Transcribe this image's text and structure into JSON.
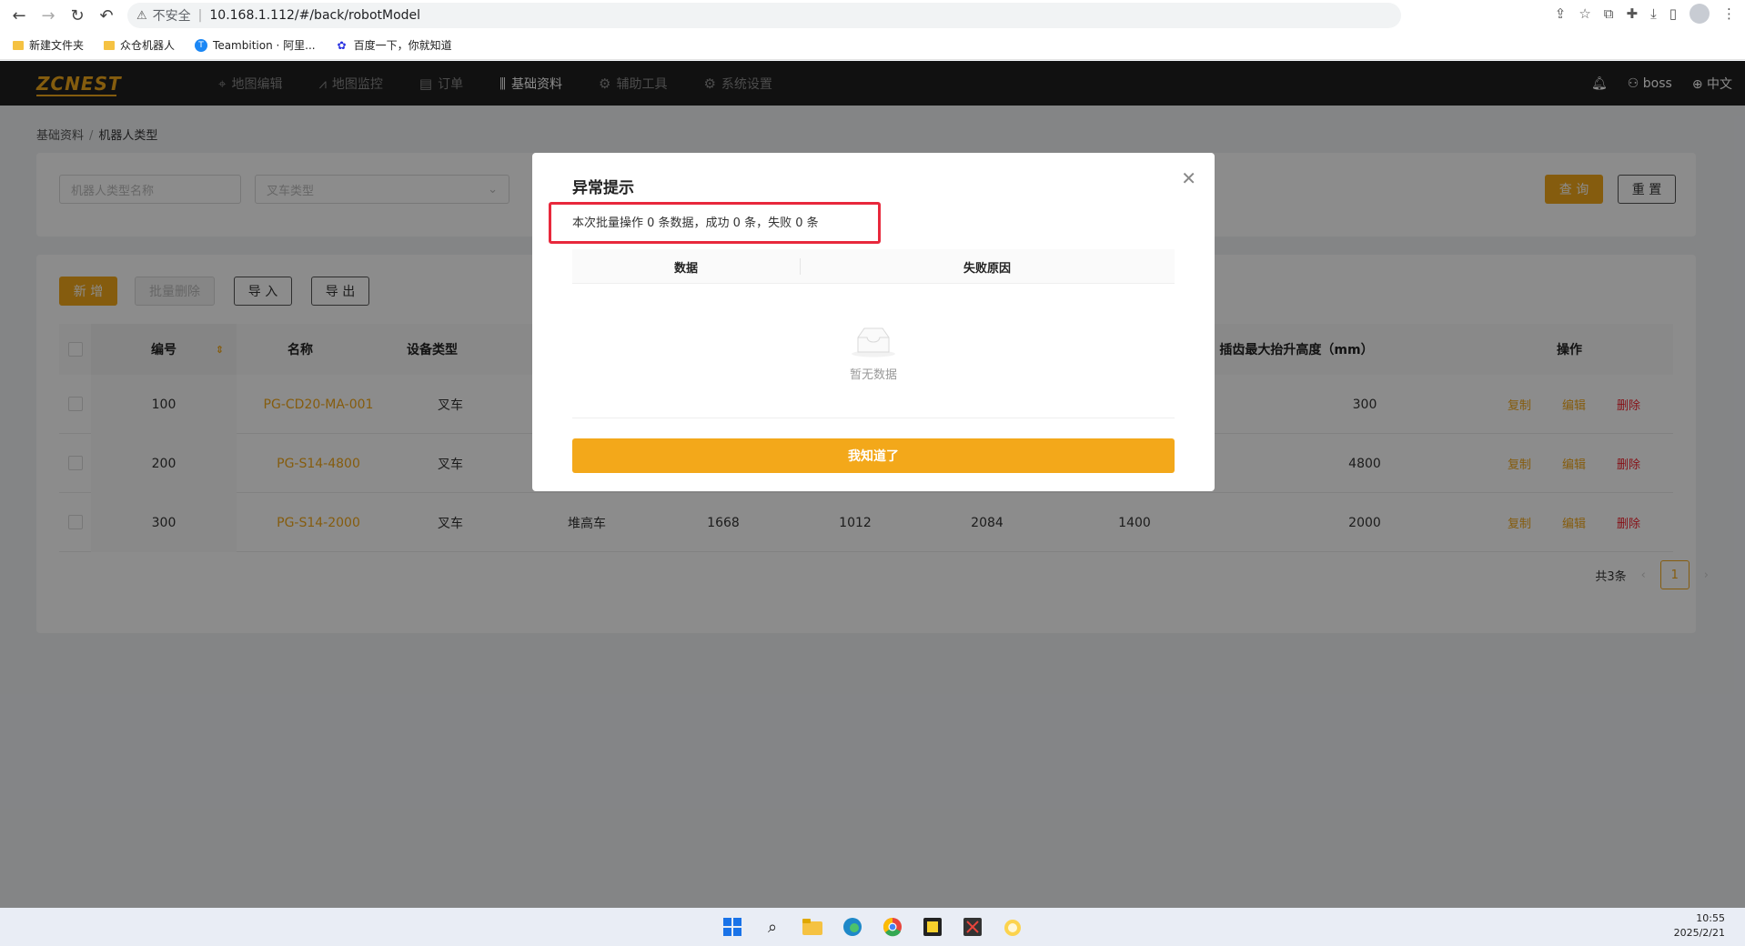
{
  "browser": {
    "insecure_label": "不安全",
    "url": "10.168.1.112/#/back/robotModel",
    "bookmarks": [
      {
        "label": "新建文件夹"
      },
      {
        "label": "众仓机器人"
      },
      {
        "label": "Teambition · 阿里..."
      },
      {
        "label": "百度一下，你就知道"
      }
    ]
  },
  "app": {
    "logo": "ZCNEST",
    "menu": [
      {
        "label": "地图编辑",
        "icon": "map-pin-icon"
      },
      {
        "label": "地图监控",
        "icon": "chart-icon"
      },
      {
        "label": "订单",
        "icon": "document-icon"
      },
      {
        "label": "基础资料",
        "icon": "sliders-icon"
      },
      {
        "label": "辅助工具",
        "icon": "gear-icon"
      },
      {
        "label": "系统设置",
        "icon": "gear-icon"
      }
    ],
    "user": "boss",
    "language": "中文"
  },
  "breadcrumb": {
    "root": "基础资料",
    "current": "机器人类型"
  },
  "filters": {
    "name_placeholder": "机器人类型名称",
    "type_placeholder": "叉车类型",
    "query_label": "查 询",
    "reset_label": "重 置"
  },
  "toolbar": {
    "add_label": "新 增",
    "batch_delete_label": "批量删除",
    "import_label": "导 入",
    "export_label": "导 出"
  },
  "table": {
    "headers": {
      "code": "编号",
      "name": "名称",
      "device_type": "设备类型",
      "max_lift": "插齿最大抬升高度（mm）",
      "actions": "操作"
    },
    "rows": [
      {
        "code": "100",
        "name": "PG-CD20-MA-001",
        "device_type": "叉车",
        "forklift_type": "",
        "c1": "",
        "c2": "",
        "c3": "",
        "c4": "",
        "max_lift": "300"
      },
      {
        "code": "200",
        "name": "PG-S14-4800",
        "device_type": "叉车",
        "forklift_type": "",
        "c1": "",
        "c2": "",
        "c3": "",
        "c4": "",
        "max_lift": "4800"
      },
      {
        "code": "300",
        "name": "PG-S14-2000",
        "device_type": "叉车",
        "forklift_type": "堆高车",
        "c1": "1668",
        "c2": "1012",
        "c3": "2084",
        "c4": "1400",
        "max_lift": "2000"
      }
    ],
    "actions": {
      "copy": "复制",
      "edit": "编辑",
      "delete": "删除"
    }
  },
  "pagination": {
    "total": "共3条",
    "current": "1"
  },
  "modal": {
    "title": "异常提示",
    "message": "本次批量操作 0 条数据，成功 0 条，失败 0 条",
    "col_data": "数据",
    "col_reason": "失败原因",
    "empty_text": "暂无数据",
    "confirm_label": "我知道了"
  },
  "taskbar": {
    "time": "10:55",
    "date": "2025/2/21"
  }
}
